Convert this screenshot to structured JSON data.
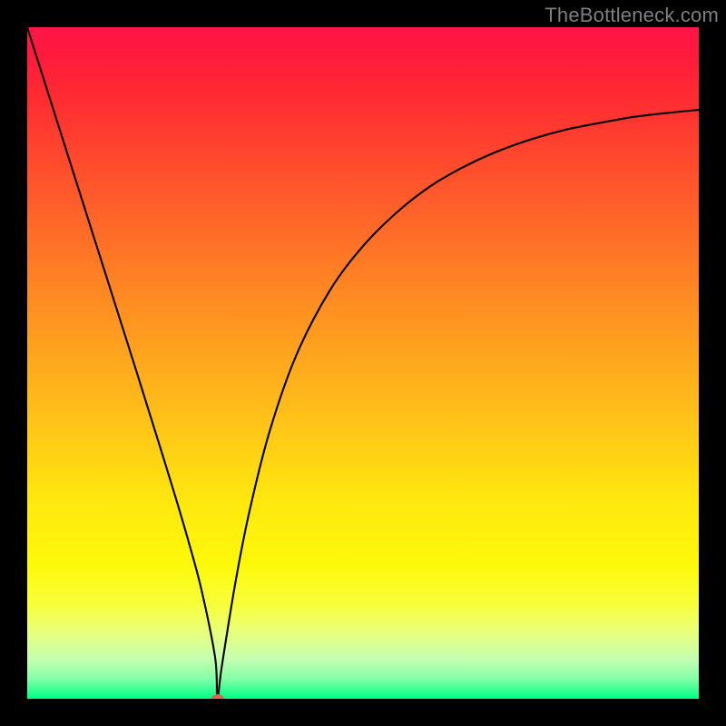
{
  "watermark": {
    "text": "TheBottleneck.com"
  },
  "chart_data": {
    "type": "line",
    "title": "",
    "xlabel": "",
    "ylabel": "",
    "xlim": [
      0,
      1
    ],
    "ylim": [
      0,
      1
    ],
    "series": [
      {
        "name": "bottleneck-curve",
        "x": [
          0.0,
          0.02,
          0.04,
          0.06,
          0.08,
          0.1,
          0.12,
          0.14,
          0.16,
          0.18,
          0.2,
          0.22,
          0.24,
          0.26,
          0.28,
          0.283,
          0.29,
          0.31,
          0.33,
          0.36,
          0.4,
          0.45,
          0.5,
          0.55,
          0.6,
          0.65,
          0.7,
          0.75,
          0.8,
          0.85,
          0.9,
          0.95,
          1.0
        ],
        "y": [
          1.0,
          0.937,
          0.874,
          0.811,
          0.748,
          0.685,
          0.622,
          0.559,
          0.496,
          0.432,
          0.368,
          0.303,
          0.235,
          0.16,
          0.06,
          0.0,
          0.05,
          0.173,
          0.275,
          0.395,
          0.51,
          0.607,
          0.674,
          0.724,
          0.763,
          0.792,
          0.815,
          0.833,
          0.847,
          0.857,
          0.866,
          0.872,
          0.877
        ]
      }
    ],
    "marker": {
      "x": 0.284,
      "y": 0.0
    },
    "background": {
      "type": "vertical-gradient",
      "stops": [
        {
          "pos": 0.0,
          "color": "#ff1648"
        },
        {
          "pos": 0.5,
          "color": "#ffa81d"
        },
        {
          "pos": 0.8,
          "color": "#fdf90a"
        },
        {
          "pos": 1.0,
          "color": "#00ff88"
        }
      ]
    }
  },
  "colors": {
    "frame": "#000000",
    "curve": "#000000",
    "marker": "#d66a4b",
    "watermark": "#7f7f7f"
  }
}
